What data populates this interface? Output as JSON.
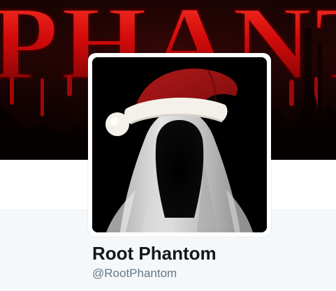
{
  "profile": {
    "display_name": "Root Phantom",
    "handle": "@RootPhantom"
  },
  "banner": {
    "text": "PHANT",
    "colors": {
      "text": "#e01010",
      "background": "#1b0303"
    }
  },
  "avatar": {
    "icon": "hooded-phantom-with-santa-hat"
  },
  "colors": {
    "display_name": "#14171a",
    "handle": "#657786",
    "lower_panel": "#f5f8fa"
  }
}
